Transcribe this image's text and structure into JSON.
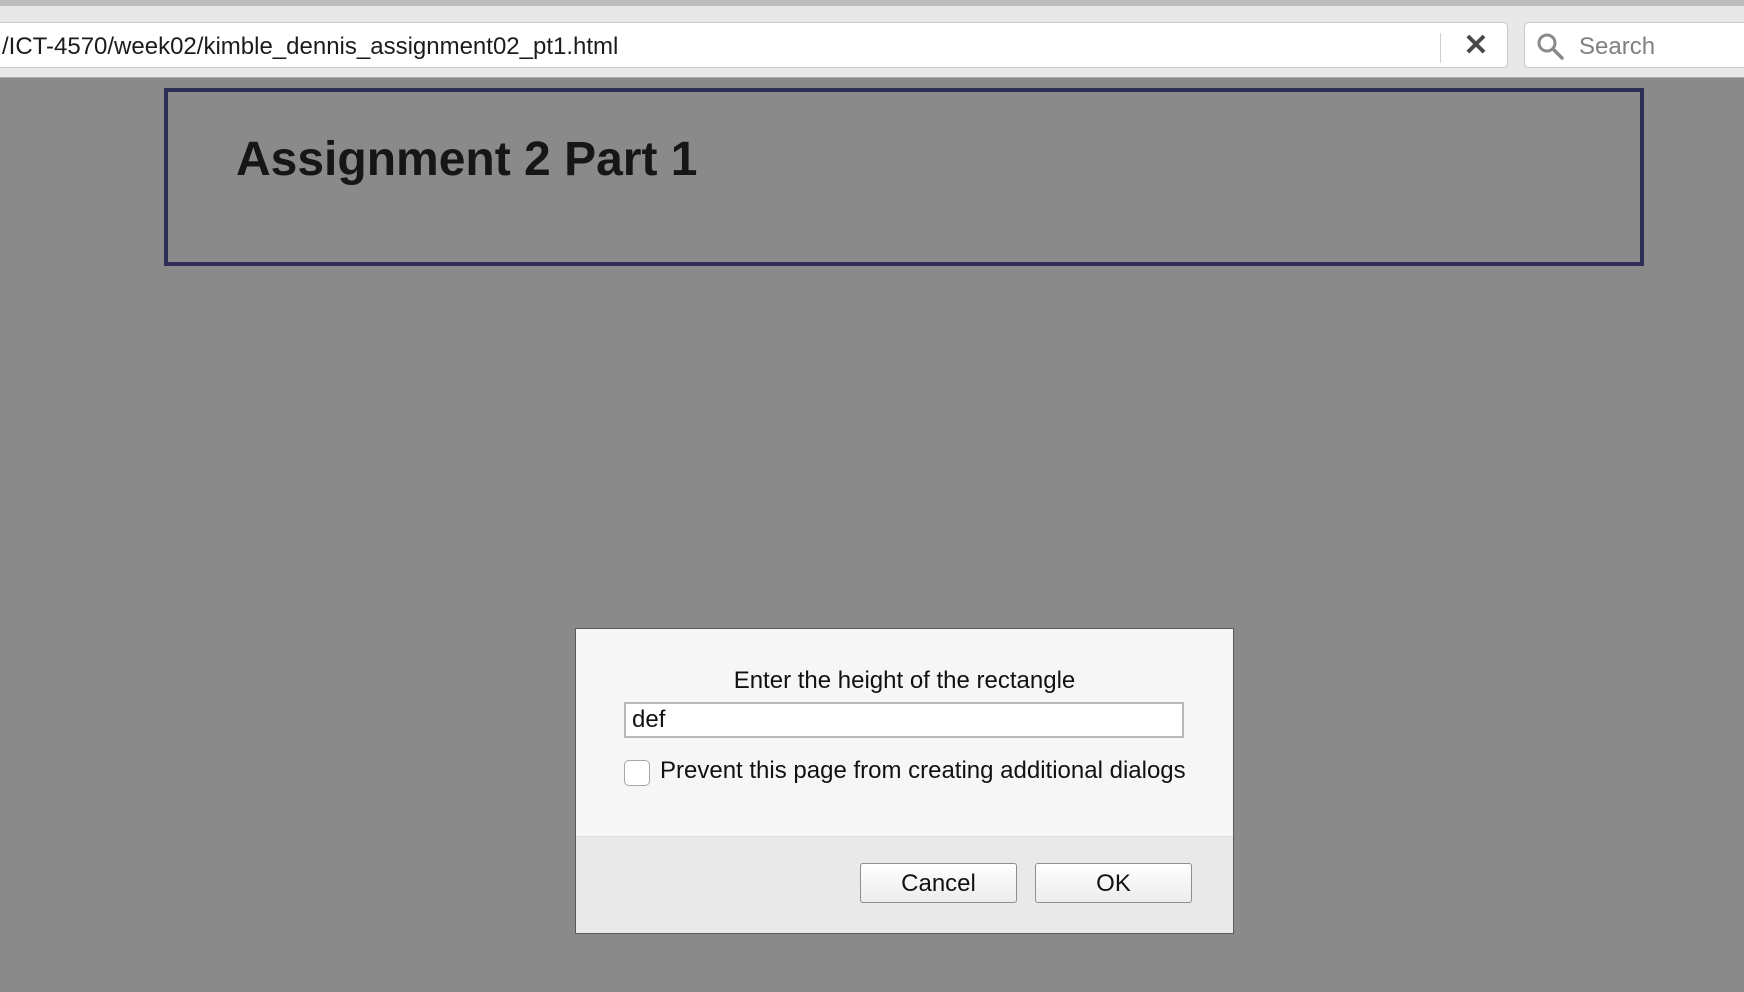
{
  "browser": {
    "url": "/ICT-4570/week02/kimble_dennis_assignment02_pt1.html",
    "stop_label": "✕",
    "search_placeholder": "Search"
  },
  "page": {
    "title": "Assignment 2 Part 1",
    "header_border_color": "#2e2d55",
    "background_color": "#8a8a8a"
  },
  "dialog": {
    "message": "Enter the height of the rectangle",
    "input_value": "def",
    "checkbox_label": "Prevent this page from creating additional dialogs",
    "checkbox_checked": false,
    "cancel_label": "Cancel",
    "ok_label": "OK"
  }
}
